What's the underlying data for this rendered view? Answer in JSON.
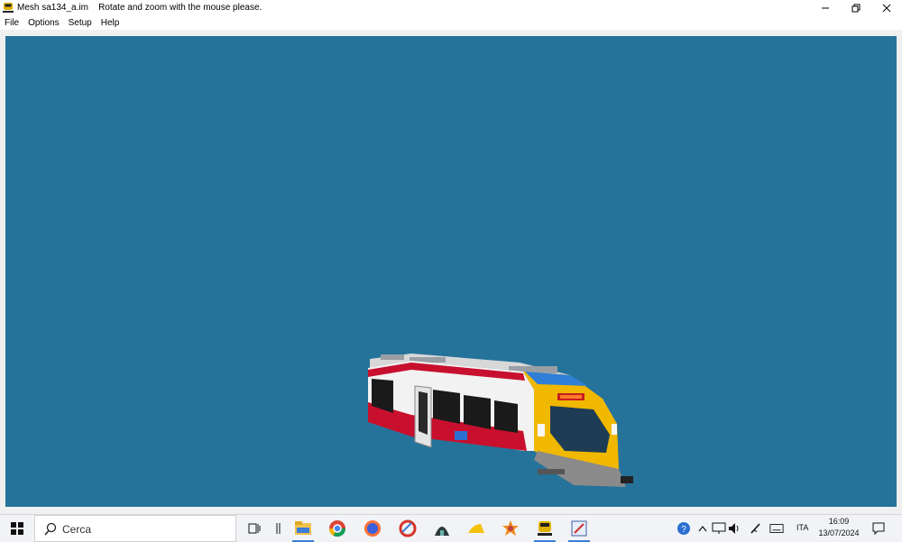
{
  "window": {
    "title": "Mesh sa134_a.im",
    "hint": "Rotate and zoom with the mouse please.",
    "controls": {
      "minimize_icon": "minimize-icon",
      "restore_icon": "restore-icon",
      "close_icon": "close-icon"
    }
  },
  "menu": {
    "items": [
      {
        "label": "File"
      },
      {
        "label": "Options"
      },
      {
        "label": "Setup"
      },
      {
        "label": "Help"
      }
    ]
  },
  "viewport": {
    "background": "#25739a",
    "model": "train-railcar-model"
  },
  "taskbar": {
    "search_label": "Cerca",
    "apps": [
      {
        "name": "task-view-icon"
      },
      {
        "name": "separator-icon"
      },
      {
        "name": "file-explorer-icon"
      },
      {
        "name": "chrome-icon"
      },
      {
        "name": "firefox-icon"
      },
      {
        "name": "ccleaner-icon"
      },
      {
        "name": "app-dome-icon"
      },
      {
        "name": "app-wedge-icon"
      },
      {
        "name": "app-star-icon"
      },
      {
        "name": "train-app-icon"
      },
      {
        "name": "editor-app-icon"
      }
    ],
    "tray": {
      "lang": "ITA",
      "time": "16:09",
      "date": "13/07/2024"
    }
  }
}
